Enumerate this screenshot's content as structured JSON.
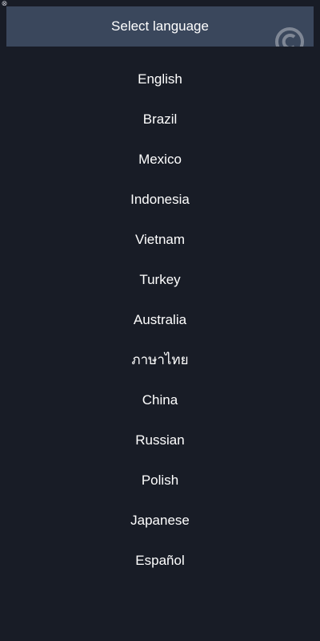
{
  "header": {
    "title": "Select language",
    "corner_icon": "copyright-icon"
  },
  "top_left_icon": "close-icon",
  "languages": [
    "English",
    "Brazil",
    "Mexico",
    "Indonesia",
    "Vietnam",
    "Turkey",
    "Australia",
    "ภาษาไทย",
    "China",
    "Russian",
    "Polish",
    "Japanese",
    "Español"
  ],
  "colors": {
    "background": "#181c26",
    "header": "#3a475c",
    "text": "#ffffff"
  }
}
